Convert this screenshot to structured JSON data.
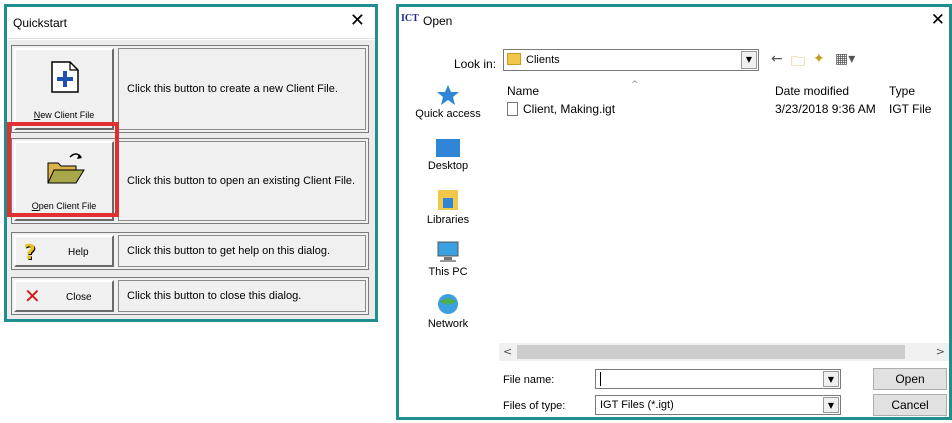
{
  "quickstart": {
    "title": "Quickstart",
    "close_glyph": "✕",
    "rows": [
      {
        "button_label_ul": "N",
        "button_label_rest": "ew Client File",
        "description": "Click this button to create a new Client File.",
        "icon": "new-file-icon"
      },
      {
        "button_label_ul": "O",
        "button_label_rest": "pen Client File",
        "description": "Click this button to open an existing Client File.",
        "icon": "open-folder-icon"
      },
      {
        "button_label": "Help",
        "description": "Click this button to get help on this dialog.",
        "icon": "help-question-icon"
      },
      {
        "button_label": "Close",
        "description": "Click this button to close this dialog.",
        "icon": "close-x-icon"
      }
    ],
    "highlight_color": "#e0302f"
  },
  "open_dialog": {
    "app_icon_text": "ICT",
    "title": "Open",
    "close_glyph": "✕",
    "look_in_label": "Look in:",
    "look_in_value": "Clients",
    "places": [
      "Quick access",
      "Desktop",
      "Libraries",
      "This PC",
      "Network"
    ],
    "columns": {
      "name": "Name",
      "date": "Date modified",
      "type": "Type"
    },
    "files": [
      {
        "name": "Client, Making.igt",
        "date": "3/23/2018 9:36 AM",
        "type": "IGT File"
      }
    ],
    "file_name_label": "File name:",
    "file_name_value": "",
    "files_of_type_label": "Files of type:",
    "files_of_type_value": "IGT Files (*.igt)",
    "open_button": "Open",
    "cancel_button": "Cancel",
    "border_color": "#1f8e91"
  }
}
